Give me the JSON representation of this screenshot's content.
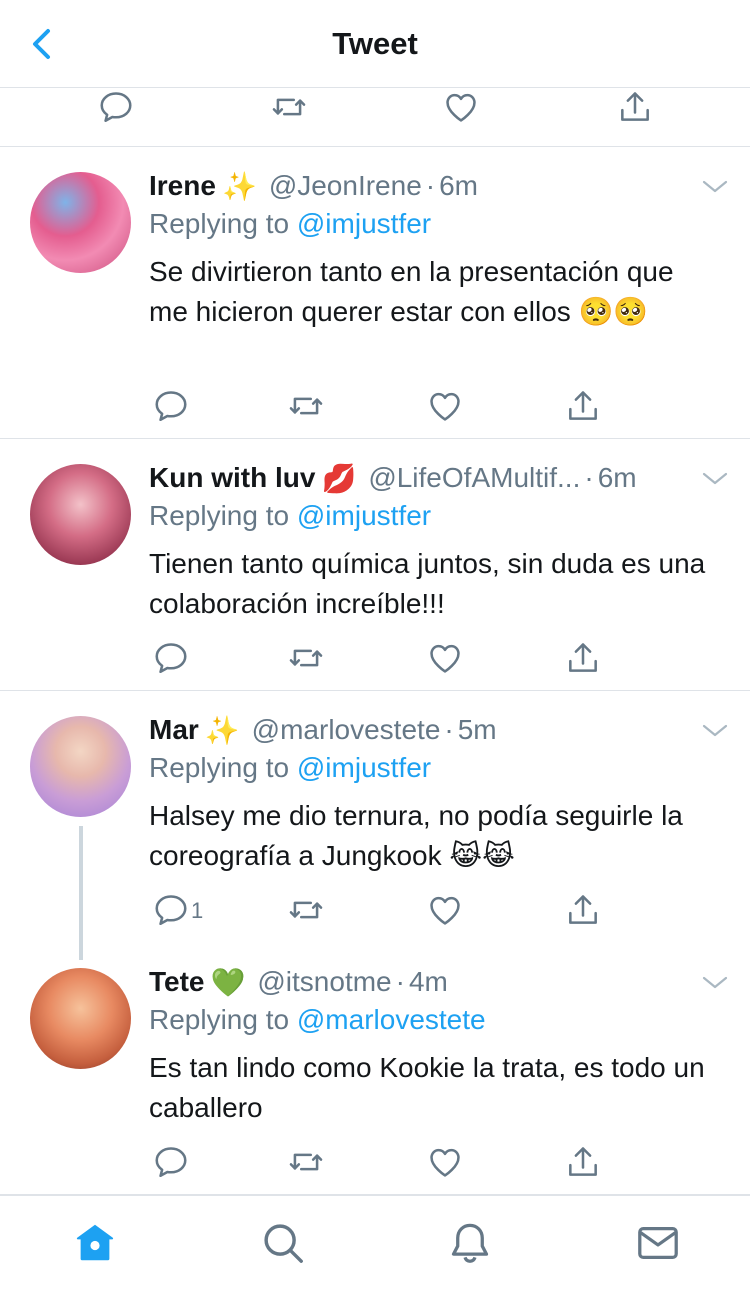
{
  "header": {
    "title": "Tweet",
    "back_icon": "chevron-left-icon"
  },
  "colors": {
    "accent": "#1da1f2",
    "secondary_text": "#657786",
    "separator": "#dfe3e8",
    "primary_text": "#14171a"
  },
  "tweets": [
    {
      "name": "Irene",
      "name_emoji": "✨",
      "handle": "@JeonIrene",
      "dot": "·",
      "time": "6m",
      "replying_prefix": "Replying to",
      "replying_to": "@imjustfer",
      "text": "Se divirtieron tanto en la presentación que me hicieron querer estar con ellos 🥺🥺",
      "reply_count": ""
    },
    {
      "name": "Kun with luv",
      "name_emoji": "💋",
      "handle": "@LifeOfAMultif...",
      "dot": "·",
      "time": "6m",
      "replying_prefix": "Replying to",
      "replying_to": "@imjustfer",
      "text": "Tienen tanto química juntos, sin duda es una colaboración increíble!!!",
      "reply_count": ""
    },
    {
      "name": "Mar",
      "name_emoji": "✨",
      "handle": "@marlovestete",
      "dot": "·",
      "time": "5m",
      "replying_prefix": "Replying to",
      "replying_to": "@imjustfer",
      "text": "Halsey me dio ternura, no podía seguirle la coreografía a Jungkook 😹😹",
      "reply_count": "1"
    },
    {
      "name": "Tete",
      "name_emoji": "💚",
      "handle": "@itsnotme",
      "dot": "·",
      "time": "4m",
      "replying_prefix": "Replying to",
      "replying_to": "@marlovestete",
      "text": "Es tan lindo como Kookie la trata, es todo un caballero",
      "reply_count": ""
    }
  ],
  "action_icons": [
    "reply-icon",
    "retweet-icon",
    "like-icon",
    "share-icon"
  ],
  "tabbar": {
    "items": [
      "home-icon",
      "search-icon",
      "notifications-icon",
      "messages-icon"
    ],
    "active": "home-icon"
  }
}
